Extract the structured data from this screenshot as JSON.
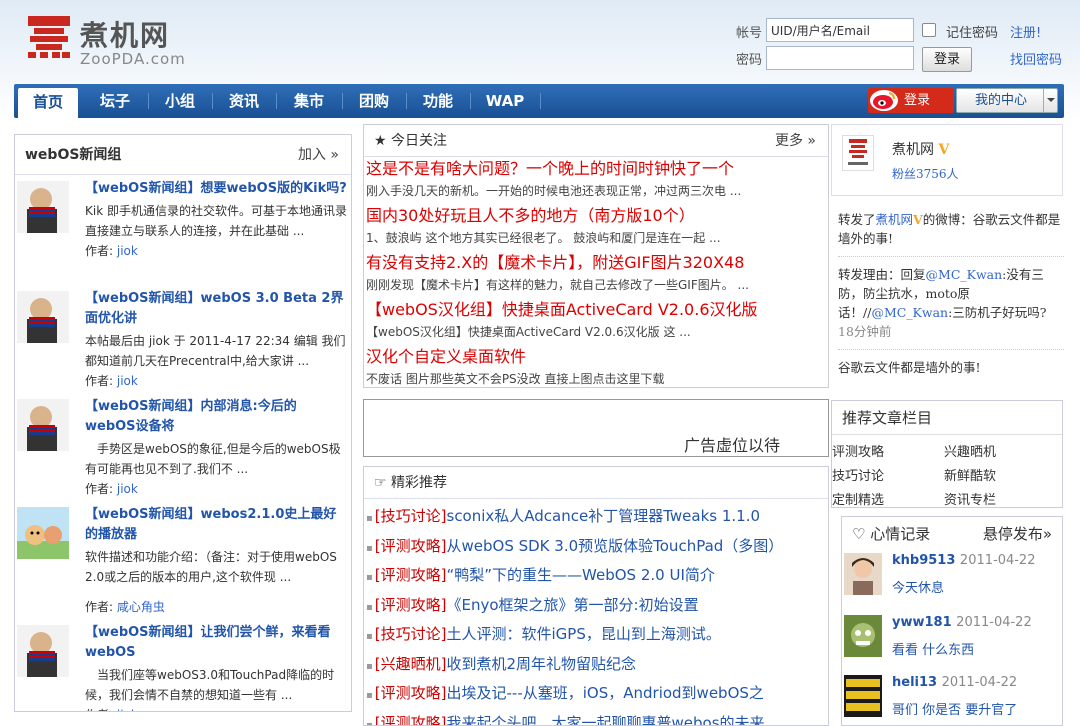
{
  "logo": {
    "cn": "煮机网",
    "en": "ZooPDA.com"
  },
  "login": {
    "account_label": "帐号",
    "account_value": "UID/用户名/Email",
    "password_label": "密码",
    "remember_label": "记住密码",
    "register_link": "注册!",
    "login_button": "登录",
    "forgot_link": "找回密码"
  },
  "nav": {
    "items": [
      "首页",
      "坛子",
      "小组",
      "资讯",
      "集市",
      "团购",
      "功能",
      "WAP"
    ],
    "weibo_login": "登录",
    "my_center": "我的中心"
  },
  "left": {
    "title": "webOS新闻组",
    "join": "加入 »",
    "author_label": "作者:",
    "items": [
      {
        "title": "【webOS新闻组】想要webOS版的Kik吗?",
        "desc": "Kik 即手机通信录的社交软件。可基于本地通讯录直接建立与联系人的连接，并在此基础 ...",
        "author": "jiok"
      },
      {
        "title": "【webOS新闻组】webOS 3.0 Beta 2界面优化讲",
        "desc": "本帖最后由 jiok 于 2011-4-17 22:34 编辑 我们都知道前几天在Precentral中,给大家讲 ...",
        "author": "jiok"
      },
      {
        "title": "【webOS新闻组】内部消息:今后的webOS设备将",
        "desc": "　手势区是webOS的象征,但是今后的webOS极有可能再也见不到了.我们不 ...",
        "author": "jiok"
      },
      {
        "title": "【webOS新闻组】webos2.1.0史上最好的播放器",
        "desc": "软件描述和功能介绍：（备注：对于使用webOS 2.0或之后的版本的用户,这个软件现 ...",
        "author": "咸心角虫"
      },
      {
        "title": "【webOS新闻组】让我们尝个鲜，来看看webOS",
        "desc": "　当我们座等webOS3.0和TouchPad降临的时候，我们会情不自禁的想知道一些有 ...",
        "author": "jiok"
      }
    ]
  },
  "today": {
    "title": "★ 今日关注",
    "more": "更多 »",
    "items": [
      {
        "title": "这是不是有啥大问题？一个晚上的时间时钟快了一个",
        "desc": "刚入手没几天的新机。一开始的时候电池还表现正常，冲过两三次电 ..."
      },
      {
        "title": "国内30处好玩且人不多的地方（南方版10个）",
        "desc": "1、鼓浪屿 这个地方其实已经很老了。 鼓浪屿和厦门是连在一起 ..."
      },
      {
        "title": "有没有支持2.X的【魔术卡片】，附送GIF图片320X48",
        "desc": "刚刚发现【魔术卡片】有这样的魅力，就自己去修改了一些GIF图片。 ..."
      },
      {
        "title": "【webOS汉化组】快捷桌面ActiveCard V2.0.6汉化版",
        "desc": "【webOS汉化组】快捷桌面ActiveCard V2.0.6汉化版 这 ..."
      },
      {
        "title": "汉化个自定义桌面软件",
        "desc": "不废话 图片那些英文不会PS没改 直接上图点击这里下载"
      }
    ]
  },
  "ad": {
    "text": "广告虚位以待"
  },
  "recommend": {
    "title": "☞ 精彩推荐",
    "items": [
      {
        "cat": "[技巧讨论]",
        "text": "sconix私人Adcance补丁管理器Tweaks 1.1.0"
      },
      {
        "cat": "[评测攻略]",
        "text": "从webOS SDK 3.0预览版体验TouchPad（多图）"
      },
      {
        "cat": "[评测攻略]",
        "text": "“鸭梨”下的重生——WebOS 2.0 UI简介"
      },
      {
        "cat": "[评测攻略]",
        "text": "《Enyo框架之旅》第一部分:初始设置"
      },
      {
        "cat": "[技巧讨论]",
        "text": "土人评测：软件iGPS，昆山到上海测试。"
      },
      {
        "cat": "[兴趣晒机]",
        "text": "收到煮机2周年礼物留贴纪念"
      },
      {
        "cat": "[评测攻略]",
        "text": "出埃及记---从塞班，iOS，Andriod到webOS之"
      },
      {
        "cat": "[评测攻略]",
        "text": "我来起个头吧，大家一起聊聊惠普webos的未来"
      }
    ]
  },
  "profile": {
    "name": "煮机网",
    "fans": "粉丝3756人"
  },
  "feed": {
    "repost_prefix": "转发了",
    "repost_user": "煮机网",
    "repost_suffix": "的微博：谷歌云文件都是墙外的事!",
    "reason_prefix": "转发理由：回复",
    "mention1": "@MC_Kwan",
    "reason_text": ":没有三防，防尘抗水，moto原话！//",
    "mention2": "@MC_Kwan",
    "reason_end": ":三防机子好玩吗?",
    "time": "18分钟前",
    "next": "谷歌云文件都是墙外的事!"
  },
  "columns": {
    "title": "推荐文章栏目",
    "items": [
      "评测攻略",
      "兴趣晒机",
      "技巧讨论",
      "新鲜酷软",
      "定制精选",
      "资讯专栏"
    ]
  },
  "mood": {
    "title": "♡ 心情记录",
    "publish": "悬停发布»",
    "items": [
      {
        "user": "khb9513",
        "date": "2011-04-22",
        "msg": "今天休息"
      },
      {
        "user": "yww181",
        "date": "2011-04-22",
        "msg": "看看 什么东西"
      },
      {
        "user": "heli13",
        "date": "2011-04-22",
        "msg": "哥们 你是否 要升官了"
      }
    ]
  },
  "colors": {
    "nav": "#1a4f93",
    "link": "#2255aa",
    "headline": "#dd0000",
    "weibo": "#d42a1a"
  }
}
